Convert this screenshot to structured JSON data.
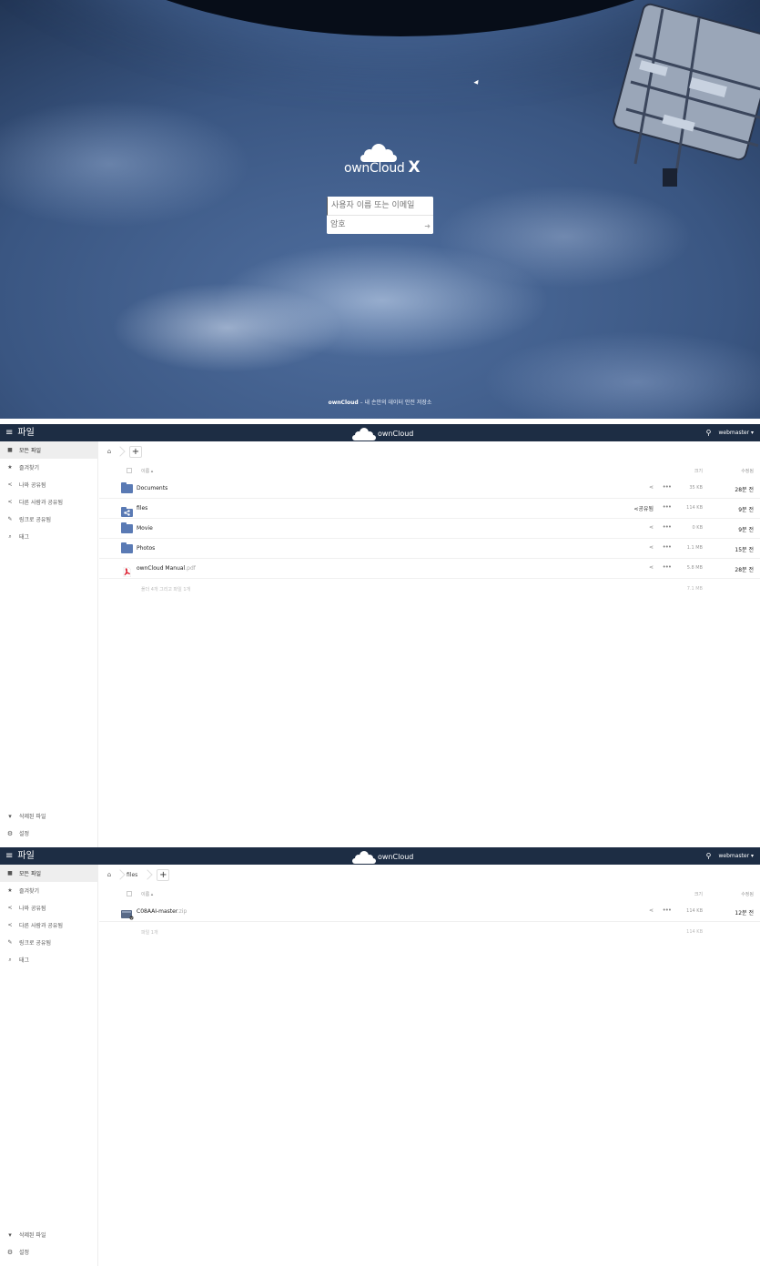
{
  "login": {
    "brand_name": "ownCloud",
    "brand_suffix": "X",
    "username_placeholder": "사용자 이름 또는 이메일",
    "password_placeholder": "암호",
    "tagline_brand": "ownCloud",
    "tagline_rest": " – 내 손안의 데이터 안전 저장소"
  },
  "app": {
    "menu_label": "파일",
    "brand": "ownCloud",
    "user": "webmaster ▾"
  },
  "sidebar": {
    "items": [
      {
        "icon": "■",
        "label": "모든 파일"
      },
      {
        "icon": "★",
        "label": "즐겨찾기"
      },
      {
        "icon": "<",
        "label": "나와 공유됨"
      },
      {
        "icon": "<",
        "label": "다른 사람과 공유됨"
      },
      {
        "icon": "✎",
        "label": "링크로 공유됨"
      },
      {
        "icon": "⌕",
        "label": "태그"
      }
    ],
    "bottom": [
      {
        "icon": "▾",
        "label": "삭제된 파일"
      },
      {
        "icon": "⚙",
        "label": "설정"
      }
    ]
  },
  "table_header": {
    "name": "이름 ▴",
    "size": "크기",
    "modified": "수정됨"
  },
  "view1": {
    "rows": [
      {
        "type": "folder",
        "name": "Documents",
        "ext": "",
        "share": "",
        "size": "35 KB",
        "modified": "28분 전"
      },
      {
        "type": "shared-folder",
        "name": "files",
        "ext": "",
        "share": "공유됨",
        "size": "114 KB",
        "modified": "9분 전"
      },
      {
        "type": "folder",
        "name": "Movie",
        "ext": "",
        "share": "",
        "size": "0 KB",
        "modified": "9분 전"
      },
      {
        "type": "folder",
        "name": "Photos",
        "ext": "",
        "share": "",
        "size": "1.1 MB",
        "modified": "15분 전"
      },
      {
        "type": "pdf",
        "name": "ownCloud Manual",
        "ext": ".pdf",
        "share": "",
        "size": "5.8 MB",
        "modified": "28분 전"
      }
    ],
    "summary": "폴더 4개 그리고 파일 1개",
    "summary_size": "7.1 MB"
  },
  "view2": {
    "breadcrumb": "files",
    "rows": [
      {
        "type": "zip",
        "name": "C08AAI-master",
        "ext": ".zip",
        "share": "",
        "size": "114 KB",
        "modified": "12분 전"
      }
    ],
    "summary": "파일 1개",
    "summary_size": "114 KB"
  }
}
